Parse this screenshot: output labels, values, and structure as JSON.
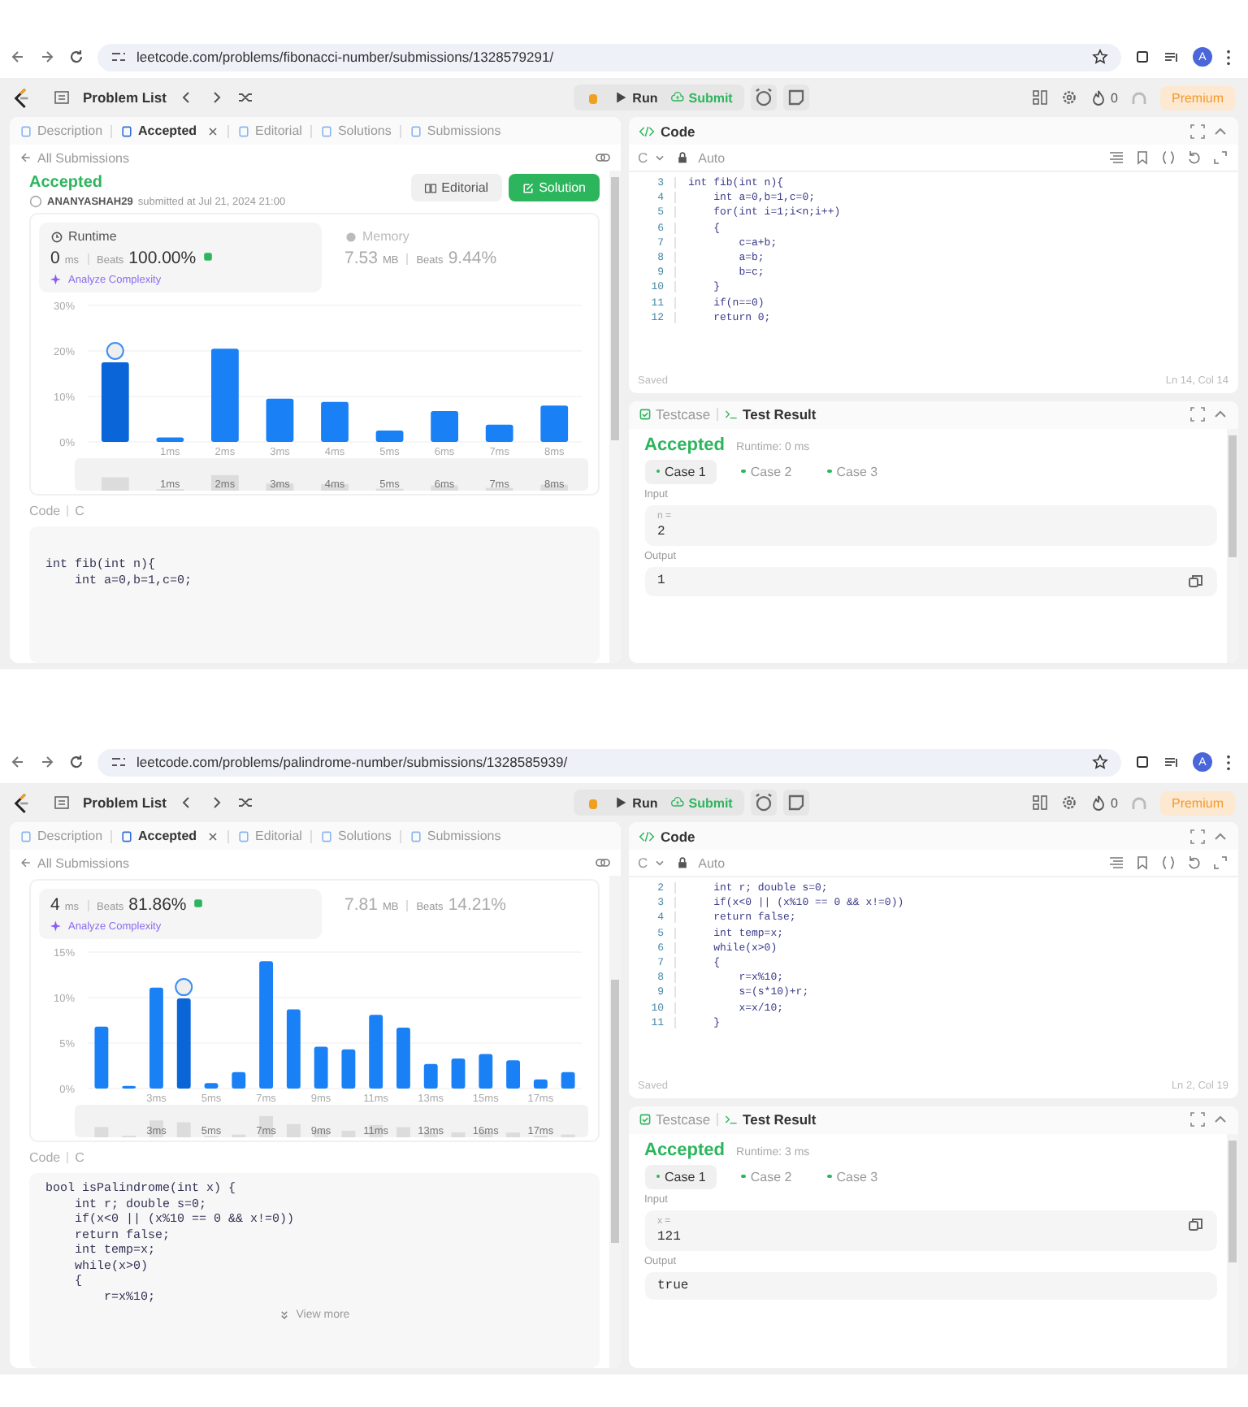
{
  "screens": [
    {
      "browser": {
        "url": "leetcode.com/problems/fibonacci-number/submissions/1328579291/",
        "profile_initial": "A"
      },
      "toolbar": {
        "problem_list": "Problem List",
        "run": "Run",
        "submit": "Submit",
        "coins": "0",
        "premium": "Premium"
      },
      "left_tabs": [
        {
          "label": "Description",
          "selected": false,
          "closable": false
        },
        {
          "label": "Accepted",
          "selected": true,
          "closable": true
        },
        {
          "label": "Editorial",
          "selected": false,
          "closable": false
        },
        {
          "label": "Solutions",
          "selected": false,
          "closable": false
        },
        {
          "label": "Submissions",
          "selected": false,
          "closable": false
        }
      ],
      "back_link": "All Submissions",
      "header": {
        "status": "Accepted",
        "user": "ANANYASHAH29",
        "submitted": "submitted at Jul 21, 2024 21:00",
        "editorial_button": "Editorial",
        "solution_button": "Solution"
      },
      "runtime": {
        "label": "Runtime",
        "value": "0",
        "unit": "ms",
        "beats_label": "Beats",
        "beats": "100.00%",
        "analyze": "Analyze Complexity"
      },
      "memory": {
        "label": "Memory",
        "value": "7.53",
        "unit": "MB",
        "beats_label": "Beats",
        "beats": "9.44%"
      },
      "submission_chart": {
        "bar_states": [
          {
            "selected": true
          },
          {
            "selected": false
          },
          {
            "selected": false
          },
          {
            "selected": false
          },
          {
            "selected": false
          },
          {
            "selected": false
          },
          {
            "selected": false
          },
          {
            "selected": false
          },
          {
            "selected": false
          }
        ],
        "chart_data": {
          "type": "bar",
          "x": [
            0,
            1,
            2,
            3,
            4,
            5,
            6,
            7,
            8
          ],
          "values": [
            17.5,
            1,
            20.5,
            9.5,
            8.8,
            2.5,
            6.8,
            3.8,
            8
          ],
          "xlim": [
            -0.5,
            8.5
          ],
          "ylim": [
            0,
            30
          ],
          "yticks": [
            {
              "value": 0,
              "label": "0%"
            },
            {
              "value": 10,
              "label": "10%"
            },
            {
              "value": 20,
              "label": "20%"
            },
            {
              "value": 30,
              "label": "30%"
            }
          ],
          "xticks": [
            {
              "value": 1,
              "label": "1ms"
            },
            {
              "value": 2,
              "label": "2ms"
            },
            {
              "value": 3,
              "label": "3ms"
            },
            {
              "value": 4,
              "label": "4ms"
            },
            {
              "value": 5,
              "label": "5ms"
            },
            {
              "value": 6,
              "label": "6ms"
            },
            {
              "value": 7,
              "label": "7ms"
            },
            {
              "value": 8,
              "label": "8ms"
            }
          ]
        },
        "navigator_labels": [
          "1ms",
          "2ms",
          "3ms",
          "4ms",
          "5ms",
          "6ms",
          "7ms",
          "8ms"
        ]
      },
      "code_section": {
        "label": "Code",
        "language": "C",
        "lines": [
          "int fib(int n){",
          "    int a=0,b=1,c=0;"
        ]
      },
      "editor": {
        "title": "Code",
        "language": "C",
        "mode": "Auto",
        "status": "Saved",
        "position": "Ln 14, Col 14",
        "lines": [
          {
            "number": "3",
            "text": "int fib(int n){"
          },
          {
            "number": "4",
            "text": "    int a=0,b=1,c=0;"
          },
          {
            "number": "5",
            "text": "    for(int i=1;i<n;i++)"
          },
          {
            "number": "6",
            "text": "    {"
          },
          {
            "number": "7",
            "text": "        c=a+b;"
          },
          {
            "number": "8",
            "text": "        a=b;"
          },
          {
            "number": "9",
            "text": "        b=c;"
          },
          {
            "number": "10",
            "text": "    }"
          },
          {
            "number": "11",
            "text": "    if(n==0)"
          },
          {
            "number": "12",
            "text": "    return 0;"
          }
        ]
      },
      "result_tabs": [
        {
          "label": "Testcase",
          "selected": false
        },
        {
          "label": "Test Result",
          "selected": true
        }
      ],
      "result": {
        "status": "Accepted",
        "runtime": "Runtime: 0 ms",
        "cases": [
          {
            "label": "Case 1",
            "selected": true
          },
          {
            "label": "Case 2",
            "selected": false
          },
          {
            "label": "Case 3",
            "selected": false
          }
        ],
        "input_label": "Input",
        "input_name": "n =",
        "input_value": "2",
        "output_label": "Output",
        "output_value": "1",
        "input_copy_button": false,
        "output_copy_button": true
      }
    },
    {
      "browser": {
        "url": "leetcode.com/problems/palindrome-number/submissions/1328585939/",
        "profile_initial": "A"
      },
      "toolbar": {
        "problem_list": "Problem List",
        "run": "Run",
        "submit": "Submit",
        "coins": "0",
        "premium": "Premium"
      },
      "left_tabs": [
        {
          "label": "Description",
          "selected": false,
          "closable": false
        },
        {
          "label": "Accepted",
          "selected": true,
          "closable": true
        },
        {
          "label": "Editorial",
          "selected": false,
          "closable": false
        },
        {
          "label": "Solutions",
          "selected": false,
          "closable": false
        },
        {
          "label": "Submissions",
          "selected": false,
          "closable": false
        }
      ],
      "back_link": "All Submissions",
      "runtime": {
        "value": "4",
        "unit": "ms",
        "beats_label": "Beats",
        "beats": "81.86%",
        "analyze": "Analyze Complexity"
      },
      "memory": {
        "value": "7.81",
        "unit": "MB",
        "beats_label": "Beats",
        "beats": "14.21%"
      },
      "submission_chart": {
        "bar_states": [
          {
            "selected": false
          },
          {
            "selected": false
          },
          {
            "selected": false
          },
          {
            "selected": true
          },
          {
            "selected": false
          },
          {
            "selected": false
          },
          {
            "selected": false
          },
          {
            "selected": false
          },
          {
            "selected": false
          },
          {
            "selected": false
          },
          {
            "selected": false
          },
          {
            "selected": false
          },
          {
            "selected": false
          },
          {
            "selected": false
          },
          {
            "selected": false
          },
          {
            "selected": false
          },
          {
            "selected": false
          },
          {
            "selected": false
          }
        ],
        "chart_data": {
          "type": "bar",
          "x": [
            1,
            2,
            3,
            4,
            5,
            6,
            7,
            8,
            9,
            10,
            11,
            12,
            13,
            14,
            15,
            16,
            17,
            18
          ],
          "values": [
            6.8,
            0.3,
            11.1,
            9.9,
            0.6,
            1.8,
            14,
            8.7,
            4.6,
            4.3,
            8.1,
            6.7,
            2.7,
            3.3,
            3.8,
            3.1,
            1,
            1.8
          ],
          "xlim": [
            0.5,
            18.5
          ],
          "ylim": [
            0,
            15
          ],
          "yticks": [
            {
              "value": 0,
              "label": "0%"
            },
            {
              "value": 5,
              "label": "5%"
            },
            {
              "value": 10,
              "label": "10%"
            },
            {
              "value": 15,
              "label": "15%"
            }
          ],
          "xticks": [
            {
              "value": 3,
              "label": "3ms"
            },
            {
              "value": 5,
              "label": "5ms"
            },
            {
              "value": 7,
              "label": "7ms"
            },
            {
              "value": 9,
              "label": "9ms"
            },
            {
              "value": 11,
              "label": "11ms"
            },
            {
              "value": 13,
              "label": "13ms"
            },
            {
              "value": 15,
              "label": "15ms"
            },
            {
              "value": 17,
              "label": "17ms"
            }
          ]
        },
        "navigator_labels": [
          "3ms",
          "5ms",
          "7ms",
          "9ms",
          "11ms",
          "13ms",
          "16ms",
          "17ms"
        ]
      },
      "code_section": {
        "label": "Code",
        "language": "C",
        "view_more": "View more",
        "lines": [
          "bool isPalindrome(int x) {",
          "    int r; double s=0;",
          "    if(x<0 || (x%10 == 0 && x!=0))",
          "    return false;",
          "    int temp=x;",
          "    while(x>0)",
          "    {",
          "        r=x%10;"
        ]
      },
      "editor": {
        "title": "Code",
        "language": "C",
        "mode": "Auto",
        "status": "Saved",
        "position": "Ln 2, Col 19",
        "lines": [
          {
            "number": "2",
            "text": "    int r; double s=0;"
          },
          {
            "number": "3",
            "text": "    if(x<0 || (x%10 == 0 && x!=0))"
          },
          {
            "number": "4",
            "text": "    return false;"
          },
          {
            "number": "5",
            "text": "    int temp=x;"
          },
          {
            "number": "6",
            "text": "    while(x>0)"
          },
          {
            "number": "7",
            "text": "    {"
          },
          {
            "number": "8",
            "text": "        r=x%10;"
          },
          {
            "number": "9",
            "text": "        s=(s*10)+r;"
          },
          {
            "number": "10",
            "text": "        x=x/10;"
          },
          {
            "number": "11",
            "text": "    }"
          }
        ]
      },
      "result_tabs": [
        {
          "label": "Testcase",
          "selected": false
        },
        {
          "label": "Test Result",
          "selected": true
        }
      ],
      "result": {
        "status": "Accepted",
        "runtime": "Runtime: 3 ms",
        "cases": [
          {
            "label": "Case 1",
            "selected": true
          },
          {
            "label": "Case 2",
            "selected": false
          },
          {
            "label": "Case 3",
            "selected": false
          }
        ],
        "input_label": "Input",
        "input_name": "x =",
        "input_value": "121",
        "output_label": "Output",
        "output_value": "true",
        "input_copy_button": true,
        "output_copy_button": false
      }
    }
  ]
}
